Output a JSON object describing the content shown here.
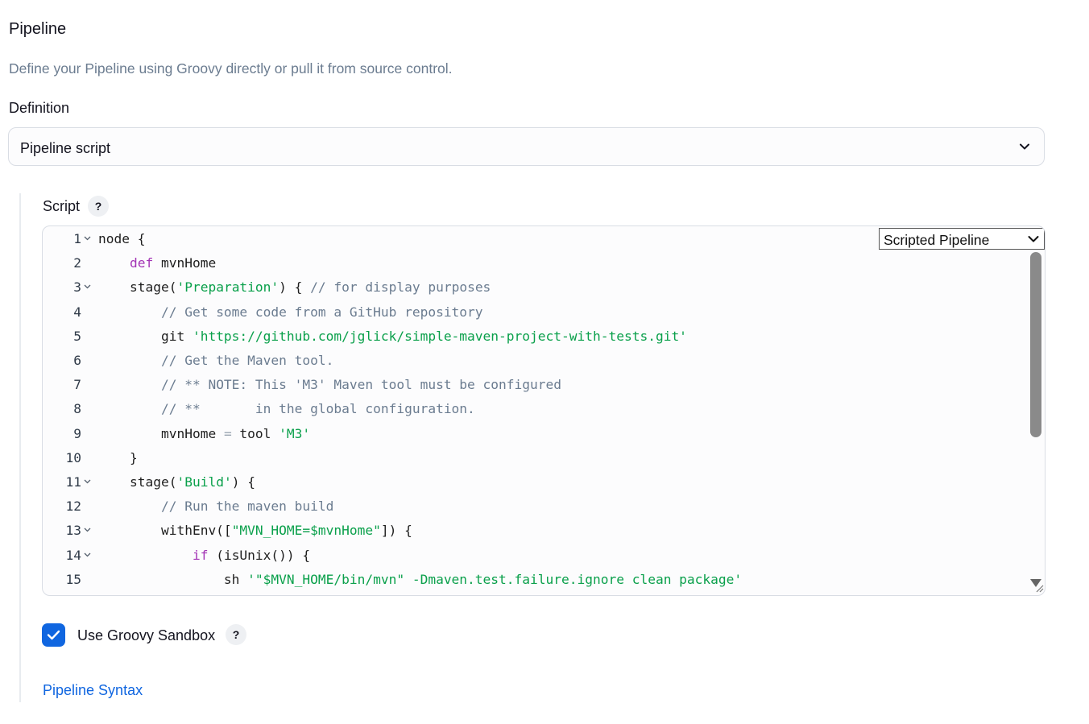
{
  "section": {
    "title": "Pipeline",
    "description": "Define your Pipeline using Groovy directly or pull it from source control."
  },
  "definition": {
    "label": "Definition",
    "selected": "Pipeline script"
  },
  "script": {
    "label": "Script",
    "help": "?",
    "style_select": "Scripted Pipeline",
    "lines": [
      {
        "num": "1",
        "foldable": true,
        "tokens": [
          {
            "t": "node {",
            "c": ""
          }
        ]
      },
      {
        "num": "2",
        "foldable": false,
        "tokens": [
          {
            "t": "    ",
            "c": ""
          },
          {
            "t": "def",
            "c": "kw"
          },
          {
            "t": " mvnHome",
            "c": ""
          }
        ]
      },
      {
        "num": "3",
        "foldable": true,
        "tokens": [
          {
            "t": "    stage(",
            "c": ""
          },
          {
            "t": "'Preparation'",
            "c": "str"
          },
          {
            "t": ") { ",
            "c": ""
          },
          {
            "t": "// for display purposes",
            "c": "com"
          }
        ]
      },
      {
        "num": "4",
        "foldable": false,
        "tokens": [
          {
            "t": "        ",
            "c": ""
          },
          {
            "t": "// Get some code from a GitHub repository",
            "c": "com"
          }
        ]
      },
      {
        "num": "5",
        "foldable": false,
        "tokens": [
          {
            "t": "        git ",
            "c": ""
          },
          {
            "t": "'https://github.com/jglick/simple-maven-project-with-tests.git'",
            "c": "str"
          }
        ]
      },
      {
        "num": "6",
        "foldable": false,
        "tokens": [
          {
            "t": "        ",
            "c": ""
          },
          {
            "t": "// Get the Maven tool.",
            "c": "com"
          }
        ]
      },
      {
        "num": "7",
        "foldable": false,
        "tokens": [
          {
            "t": "        ",
            "c": ""
          },
          {
            "t": "// ** NOTE: This 'M3' Maven tool must be configured",
            "c": "com"
          }
        ]
      },
      {
        "num": "8",
        "foldable": false,
        "tokens": [
          {
            "t": "        ",
            "c": ""
          },
          {
            "t": "// **       in the global configuration.",
            "c": "com"
          }
        ]
      },
      {
        "num": "9",
        "foldable": false,
        "tokens": [
          {
            "t": "        mvnHome ",
            "c": ""
          },
          {
            "t": "=",
            "c": "op"
          },
          {
            "t": " tool ",
            "c": ""
          },
          {
            "t": "'M3'",
            "c": "str"
          }
        ]
      },
      {
        "num": "10",
        "foldable": false,
        "tokens": [
          {
            "t": "    }",
            "c": ""
          }
        ]
      },
      {
        "num": "11",
        "foldable": true,
        "tokens": [
          {
            "t": "    stage(",
            "c": ""
          },
          {
            "t": "'Build'",
            "c": "str"
          },
          {
            "t": ") {",
            "c": ""
          }
        ]
      },
      {
        "num": "12",
        "foldable": false,
        "tokens": [
          {
            "t": "        ",
            "c": ""
          },
          {
            "t": "// Run the maven build",
            "c": "com"
          }
        ]
      },
      {
        "num": "13",
        "foldable": true,
        "tokens": [
          {
            "t": "        withEnv([",
            "c": ""
          },
          {
            "t": "\"MVN_HOME=$mvnHome\"",
            "c": "str"
          },
          {
            "t": "]) {",
            "c": ""
          }
        ]
      },
      {
        "num": "14",
        "foldable": true,
        "tokens": [
          {
            "t": "            ",
            "c": ""
          },
          {
            "t": "if",
            "c": "kw"
          },
          {
            "t": " (isUnix()) {",
            "c": ""
          }
        ]
      },
      {
        "num": "15",
        "foldable": false,
        "tokens": [
          {
            "t": "                sh ",
            "c": ""
          },
          {
            "t": "'\"$MVN_HOME/bin/mvn\" -Dmaven.test.failure.ignore clean package'",
            "c": "str"
          }
        ]
      }
    ]
  },
  "sandbox": {
    "label": "Use Groovy Sandbox",
    "checked": true,
    "help": "?"
  },
  "links": {
    "pipeline_syntax": "Pipeline Syntax"
  },
  "colors": {
    "accent": "#1066e0",
    "keyword": "#a334b5",
    "string": "#0aa04b",
    "comment": "#6b7c90"
  }
}
